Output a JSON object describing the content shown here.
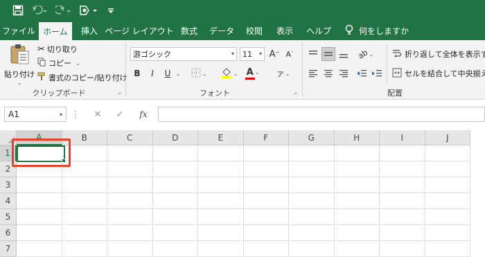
{
  "quick_access": {
    "icons": [
      "save-icon",
      "undo-icon",
      "redo-icon",
      "touch-mode-icon",
      "customize-qat-icon"
    ]
  },
  "tabs": [
    {
      "label": "ファイル"
    },
    {
      "label": "ホーム",
      "active": true
    },
    {
      "label": "挿入"
    },
    {
      "label": "ページ レイアウト"
    },
    {
      "label": "数式"
    },
    {
      "label": "データ"
    },
    {
      "label": "校閲"
    },
    {
      "label": "表示"
    },
    {
      "label": "ヘルプ"
    }
  ],
  "tell_me": "何をしますか",
  "clipboard": {
    "paste": "貼り付け",
    "cut": "切り取り",
    "copy": "コピー",
    "format_painter": "書式のコピー/貼り付け",
    "group_label": "クリップボード"
  },
  "font": {
    "family": "游ゴシック",
    "size": "11",
    "bold": "B",
    "italic": "I",
    "underline": "U",
    "grow": "A",
    "shrink": "A",
    "font_color_letter": "A",
    "phonetic": "ア",
    "group_label": "フォント",
    "fill_color": "#ffff00",
    "font_color": "#e00000"
  },
  "alignment": {
    "wrap_text": "折り返して全体を表示する",
    "merge_center": "セルを結合して中央揃え",
    "group_label": "配置"
  },
  "formula_bar": {
    "name_box": "A1",
    "fx": "fx",
    "formula": ""
  },
  "grid": {
    "columns": [
      "A",
      "B",
      "C",
      "D",
      "E",
      "F",
      "G",
      "H",
      "I",
      "J"
    ],
    "rows": [
      "1",
      "2",
      "3",
      "4",
      "5",
      "6",
      "7"
    ],
    "active_column": "A",
    "active_row": "1"
  },
  "colors": {
    "accent": "#217346",
    "highlight": "#e8402a"
  }
}
